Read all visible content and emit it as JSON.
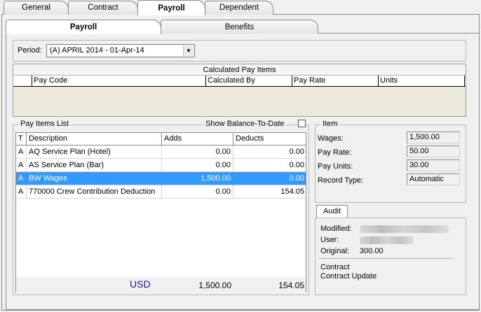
{
  "tabs_top": [
    "General",
    "Contract",
    "Payroll",
    "Dependent"
  ],
  "tabs_sub": [
    "Payroll",
    "Benefits"
  ],
  "period": {
    "label": "Period:",
    "value": "(A)  APRIL 2014 - 01-Apr-14"
  },
  "calculated": {
    "title": "Calculated Pay Items",
    "columns": [
      "Pay Code",
      "Calculated By",
      "Pay Rate",
      "Units"
    ]
  },
  "pay_items": {
    "legend": "Pay Items List",
    "show_balance_label": "Show Balance-To-Date",
    "columns": [
      "T",
      "Description",
      "Adds",
      "Deducts"
    ],
    "rows": [
      {
        "t": "A",
        "description": "AQ   Service Plan (Hotel)",
        "adds": "0.00",
        "deducts": "0.00"
      },
      {
        "t": "A",
        "description": "AS   Service Plan (Bar)",
        "adds": "0.00",
        "deducts": "0.00"
      },
      {
        "t": "A",
        "description": "BW   Wages",
        "adds": "1,500.00",
        "deducts": "0.00"
      },
      {
        "t": "A",
        "description": "770000   Crew Contribution Deduction",
        "adds": "0.00",
        "deducts": "154.05"
      }
    ],
    "totals": {
      "currency": "USD",
      "adds": "1,500.00",
      "deducts": "154.05"
    }
  },
  "item": {
    "legend": "Item",
    "wages_label": "Wages:",
    "wages_value": "1,500.00",
    "pay_rate_label": "Pay Rate:",
    "pay_rate_value": "50.00",
    "pay_units_label": "Pay Units:",
    "pay_units_value": "30.00",
    "record_type_label": "Record Type:",
    "record_type_value": "Automatic"
  },
  "audit": {
    "tab": "Audit",
    "modified_label": "Modified:",
    "user_label": "User:",
    "original_label": "Original:",
    "original_value": "300.00",
    "source_1": "Contract",
    "source_2": "Contract Update"
  },
  "colors": {
    "selection": "#3399ff",
    "calc_bg": "#ebe9d9",
    "currency_text": "#1a1a8c"
  }
}
